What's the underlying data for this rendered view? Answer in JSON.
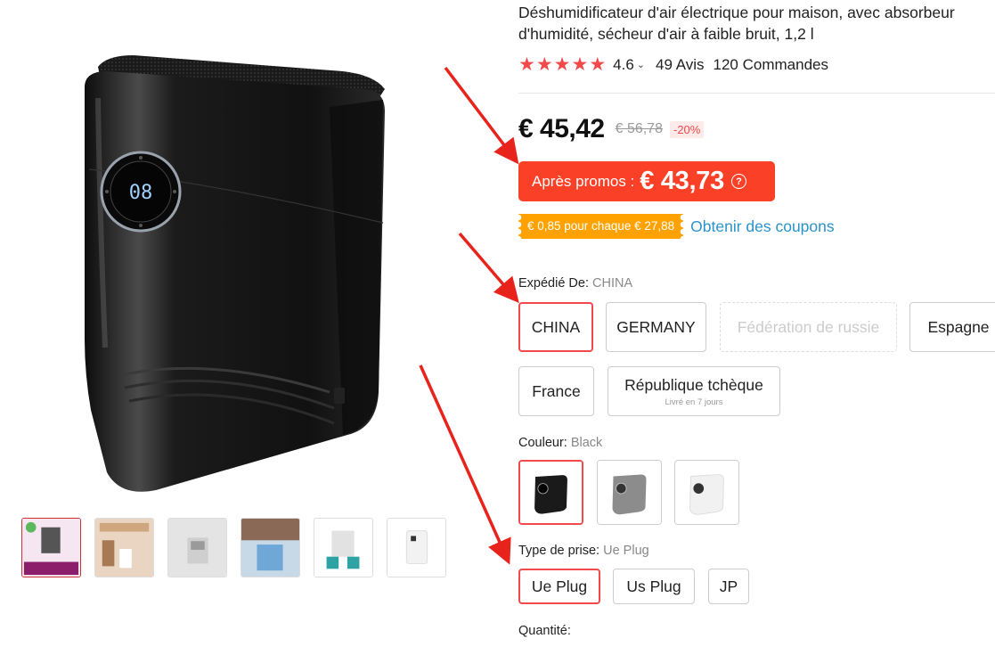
{
  "product": {
    "title": "Déshumidificateur d'air électrique pour maison, avec absorbeur d'humidité, sécheur d'air à faible bruit, 1,2 l",
    "display_reading": "08",
    "rating": "4.6",
    "reviews": "49 Avis",
    "orders": "120 Commandes"
  },
  "price": {
    "current": "€ 45,42",
    "original": "€ 56,78",
    "discount": "-20%",
    "promo_label": "Après promos :",
    "promo_price": "€ 43,73",
    "promo_help": "?"
  },
  "coupon": {
    "badge": "€ 0,85 pour chaque € 27,88",
    "link": "Obtenir des coupons"
  },
  "ship_from": {
    "label": "Expédié De:",
    "selected": "CHINA",
    "options": [
      {
        "label": "CHINA"
      },
      {
        "label": "GERMANY"
      },
      {
        "label": "Fédération de russie"
      },
      {
        "label": "Espagne"
      },
      {
        "label": "France"
      },
      {
        "label": "République tchèque",
        "sub": "Livré en 7 jours"
      }
    ]
  },
  "color": {
    "label": "Couleur:",
    "selected": "Black",
    "options": [
      "black-variant",
      "grey-variant",
      "white-variant"
    ]
  },
  "plug": {
    "label": "Type de prise:",
    "selected": "Ue Plug",
    "options": [
      "Ue Plug",
      "Us Plug",
      "JP"
    ]
  },
  "quantity": {
    "label": "Quantité:"
  },
  "colors": {
    "accent": "#f24a4a",
    "promo_bg": "#fa4128",
    "coupon_bg": "#ffa200",
    "link": "#2a93c9",
    "annotation_arrow": "#e8231c"
  },
  "icons": [
    "star-icon",
    "chevron-down-icon",
    "question-circle-icon"
  ]
}
